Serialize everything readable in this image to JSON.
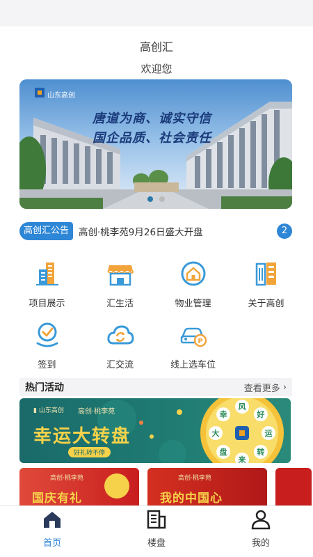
{
  "header": {
    "app_title": "高创汇",
    "welcome": "欢迎您"
  },
  "banner": {
    "logo_text": "山东高创",
    "slogan_line1": "唐道为商、诚实守信",
    "slogan_line2": "国企品质、社会责任",
    "gate_sign": "山东高创",
    "slides": 2,
    "active_slide": 1
  },
  "notice": {
    "tag": "高创汇公告",
    "text": "高创·桃李苑9月26日盛大开盘",
    "count": "2"
  },
  "menu": [
    {
      "label": "项目展示",
      "icon": "buildings-icon"
    },
    {
      "label": "汇生活",
      "icon": "storefront-icon"
    },
    {
      "label": "物业管理",
      "icon": "home-circle-icon"
    },
    {
      "label": "关于高创",
      "icon": "company-icon"
    },
    {
      "label": "签到",
      "icon": "checkin-badge-icon"
    },
    {
      "label": "汇交流",
      "icon": "cloud-sync-icon"
    },
    {
      "label": "线上选车位",
      "icon": "car-parking-icon"
    }
  ],
  "hot": {
    "title": "热门活动",
    "more": "查看更多"
  },
  "activities": [
    {
      "title": "幸运大转盘",
      "brand": "高创·桃李苑",
      "chip": "好礼转不停",
      "wheel_chars": [
        "风",
        "好",
        "运",
        "转",
        "来",
        "盘",
        "大",
        "幸"
      ]
    },
    {
      "title": "国庆有礼",
      "brand": "高创·桃李苑"
    },
    {
      "title": "我的中国心",
      "brand": "高创·桃李苑"
    }
  ],
  "tabs": [
    {
      "label": "首页",
      "icon": "home-icon",
      "active": true
    },
    {
      "label": "楼盘",
      "icon": "building-icon",
      "active": false
    },
    {
      "label": "我的",
      "icon": "user-icon",
      "active": false
    }
  ],
  "colors": {
    "accent": "#2e86d6",
    "text": "#333333",
    "section_bg": "#f3f3f5",
    "teal_card": "#1e7a72",
    "red_card": "#c81e1e"
  }
}
